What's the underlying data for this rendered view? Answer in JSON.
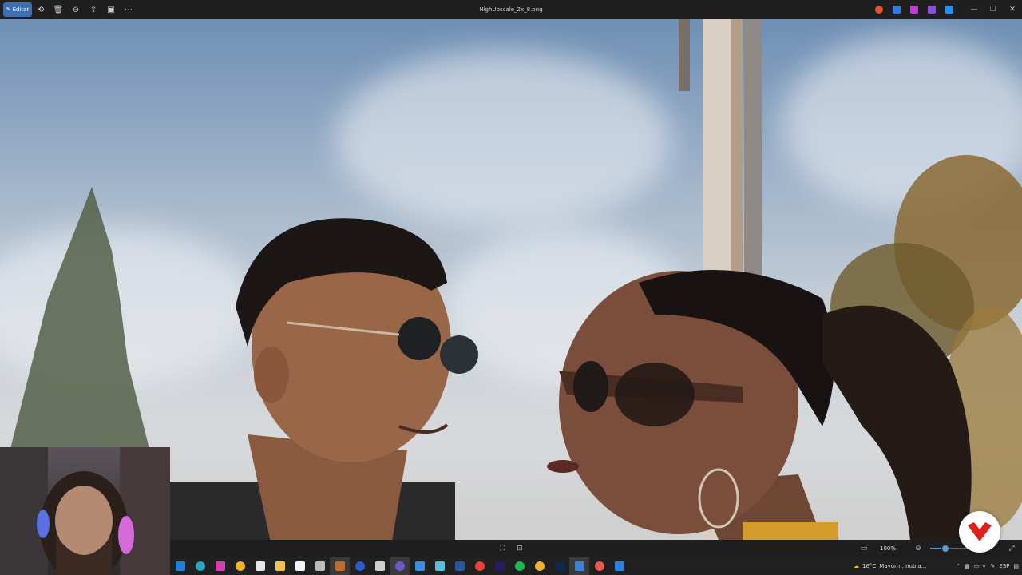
{
  "titlebar": {
    "edit_label": "Editar",
    "file_name": "HighUpscale_2x_8.png",
    "tools": [
      "rotate-icon",
      "delete-icon",
      "crop-icon",
      "share-icon",
      "gallery-icon",
      "more-icon"
    ]
  },
  "viewer": {
    "zoom_label": "100%",
    "zoom_percent": 100
  },
  "taskbar": {
    "weather_temp": "16°C",
    "weather_text": "Mayorm. nubla...",
    "lang": "ESP"
  },
  "colors": {
    "accent": "#3d6fb3",
    "brand_red": "#e01f1f"
  }
}
